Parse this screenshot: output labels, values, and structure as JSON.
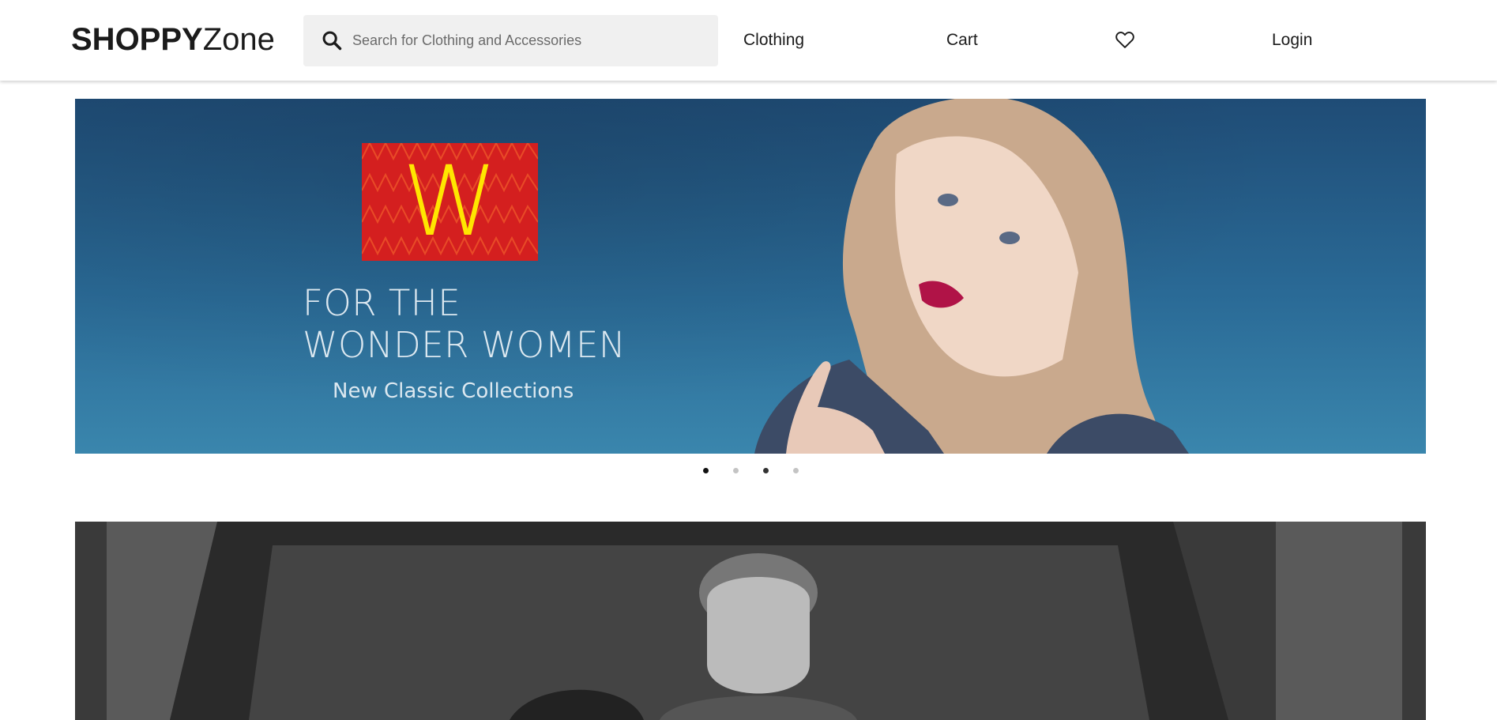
{
  "header": {
    "logo_bold": "SHOPPY",
    "logo_rest": "Zone",
    "search_placeholder": "Search for Clothing and Accessories",
    "nav": {
      "clothing": "Clothing",
      "cart": "Cart",
      "login": "Login"
    }
  },
  "carousel": {
    "brand_letter": "W",
    "headline": "FOR THE WONDER WOMEN",
    "subline": "New Classic Collections",
    "active_index": 0,
    "slide_count": 4
  },
  "colors": {
    "banner_blue": "#2a6a96",
    "brand_red": "#d41f1f",
    "brand_yellow": "#ffe600",
    "dot_active": "#111111",
    "dot_inactive": "#c4c4c4"
  },
  "icons": {
    "search": "search-icon",
    "wishlist": "heart-icon"
  }
}
